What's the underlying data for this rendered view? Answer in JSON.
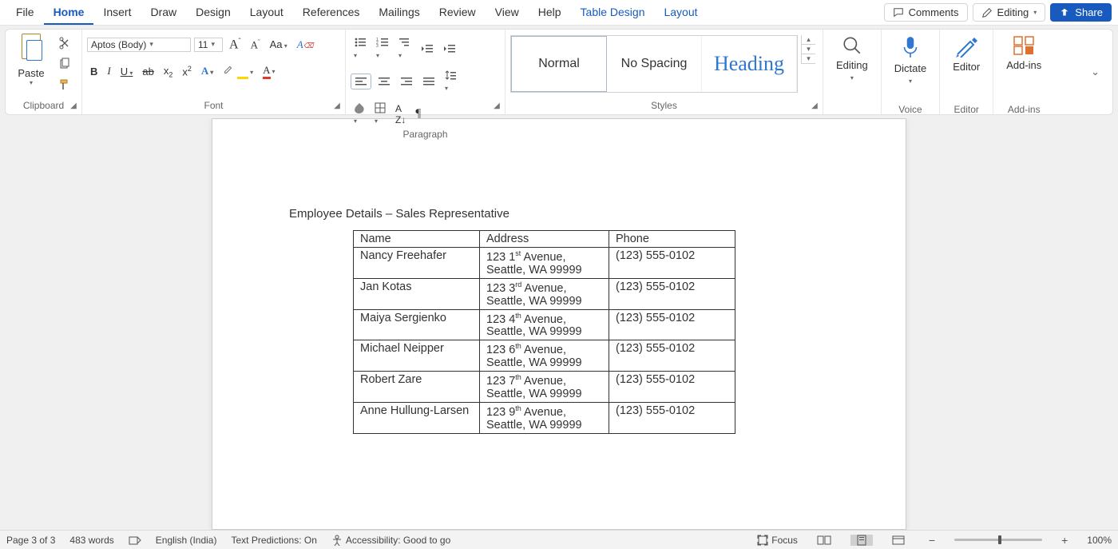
{
  "tabs": [
    "File",
    "Home",
    "Insert",
    "Draw",
    "Design",
    "Layout",
    "References",
    "Mailings",
    "Review",
    "View",
    "Help",
    "Table Design",
    "Layout"
  ],
  "active_tab": "Home",
  "titlebar": {
    "comments": "Comments",
    "editing": "Editing",
    "share": "Share"
  },
  "ribbon": {
    "clipboard": {
      "label": "Clipboard",
      "paste": "Paste"
    },
    "font": {
      "label": "Font",
      "name": "Aptos (Body)",
      "size": "11",
      "grow": "A",
      "shrink": "A",
      "case": "Aa",
      "clear": "A",
      "bold": "B",
      "italic": "I",
      "underline": "U",
      "strike": "ab",
      "sub": "x",
      "sup": "x",
      "effects": "A",
      "highlight": "",
      "color": "A"
    },
    "paragraph": {
      "label": "Paragraph"
    },
    "styles": {
      "label": "Styles",
      "items": [
        "Normal",
        "No Spacing",
        "Heading"
      ]
    },
    "editing_group": {
      "label": "Editing",
      "find": "Editing"
    },
    "voice": {
      "label": "Voice",
      "dictate": "Dictate"
    },
    "editor": {
      "label": "Editor",
      "btn": "Editor"
    },
    "addins": {
      "label": "Add-ins",
      "btn": "Add-ins"
    }
  },
  "document": {
    "heading": "Employee Details – Sales Representative",
    "columns": [
      "Name",
      "Address",
      "Phone"
    ],
    "rows": [
      {
        "name": "Nancy Freehafer",
        "addr_line1": "123 1",
        "addr_sup": "st",
        "addr_line1_tail": " Avenue,",
        "addr_line2": "Seattle, WA 99999",
        "phone": "(123) 555-0102"
      },
      {
        "name": "Jan Kotas",
        "addr_line1": "123 3",
        "addr_sup": "rd",
        "addr_line1_tail": " Avenue,",
        "addr_line2": "Seattle, WA 99999",
        "phone": "(123) 555-0102"
      },
      {
        "name": "Maiya Sergienko",
        "addr_line1": "123 4",
        "addr_sup": "th",
        "addr_line1_tail": " Avenue,",
        "addr_line2": "Seattle, WA 99999",
        "phone": "(123) 555-0102"
      },
      {
        "name": "Michael Neipper",
        "addr_line1": "123 6",
        "addr_sup": "th",
        "addr_line1_tail": " Avenue,",
        "addr_line2": "Seattle, WA 99999",
        "phone": "(123) 555-0102"
      },
      {
        "name": "Robert Zare",
        "addr_line1": "123 7",
        "addr_sup": "th",
        "addr_line1_tail": " Avenue,",
        "addr_line2": "Seattle, WA 99999",
        "phone": "(123) 555-0102"
      },
      {
        "name": "Anne Hullung-Larsen",
        "addr_line1": "123 9",
        "addr_sup": "th",
        "addr_line1_tail": " Avenue,",
        "addr_line2": "Seattle, WA 99999",
        "phone": "(123) 555-0102"
      }
    ]
  },
  "statusbar": {
    "page": "Page 3 of 3",
    "words": "483 words",
    "language": "English (India)",
    "predictions": "Text Predictions: On",
    "accessibility": "Accessibility: Good to go",
    "focus": "Focus",
    "zoom": "100%"
  }
}
